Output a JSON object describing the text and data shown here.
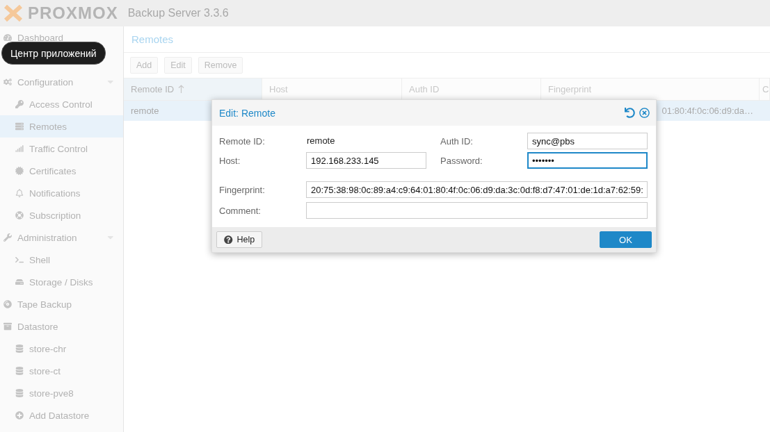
{
  "header": {
    "logo": "PROXMOX",
    "product": "Backup Server 3.3.6"
  },
  "tooltip": "Центр приложений",
  "sidebar": {
    "items": [
      {
        "label": "Dashboard",
        "selected": false
      },
      {
        "label": "Configuration",
        "expanded": true,
        "selected": false,
        "children": [
          {
            "label": "Access Control",
            "selected": false
          },
          {
            "label": "Remotes",
            "selected": true
          },
          {
            "label": "Traffic Control",
            "selected": false
          },
          {
            "label": "Certificates",
            "selected": false
          },
          {
            "label": "Notifications",
            "selected": false
          },
          {
            "label": "Subscription",
            "selected": false
          }
        ]
      },
      {
        "label": "Administration",
        "expanded": true,
        "selected": false,
        "children": [
          {
            "label": "Shell",
            "selected": false
          },
          {
            "label": "Storage / Disks",
            "selected": false
          }
        ]
      },
      {
        "label": "Tape Backup",
        "selected": false
      },
      {
        "label": "Datastore",
        "selected": false,
        "children": [
          {
            "label": "store-chr",
            "selected": false
          },
          {
            "label": "store-ct",
            "selected": false
          },
          {
            "label": "store-pve8",
            "selected": false
          },
          {
            "label": "Add Datastore",
            "selected": false
          }
        ]
      }
    ]
  },
  "panel": {
    "title": "Remotes",
    "toolbar": [
      "Add",
      "Edit",
      "Remove"
    ],
    "table": {
      "columns": [
        {
          "label": "Remote ID",
          "sorted": true
        },
        {
          "label": "Host",
          "sorted": false
        },
        {
          "label": "Auth ID",
          "sorted": false
        },
        {
          "label": "Fingerprint",
          "sorted": false
        },
        {
          "label": "C",
          "sorted": false
        }
      ],
      "rows": [
        {
          "selected": true,
          "cells": [
            "remote",
            "",
            "",
            "01:80:4f:0c:06:d9:da…",
            ""
          ]
        }
      ]
    }
  },
  "dialog": {
    "title": "Edit: Remote",
    "fields": [
      {
        "label": "Remote ID:",
        "kind": "static",
        "value": "remote",
        "focused": false
      },
      {
        "label": "Auth ID:",
        "kind": "input",
        "value": "sync@pbs",
        "focused": false
      },
      {
        "label": "Host:",
        "kind": "input",
        "value": "192.168.233.145",
        "focused": false
      },
      {
        "label": "Password:",
        "kind": "input",
        "value": "•••••••",
        "focused": true
      }
    ],
    "wide_fields": [
      {
        "label": "Fingerprint:",
        "value": "20:75:38:98:0c:89:a4:c9:64:01:80:4f:0c:06:d9:da:3c:0d:f8:d7:47:01:de:1d:a7:62:59:"
      },
      {
        "label": "Comment:"
      }
    ],
    "help": "Help",
    "ok": "OK"
  }
}
